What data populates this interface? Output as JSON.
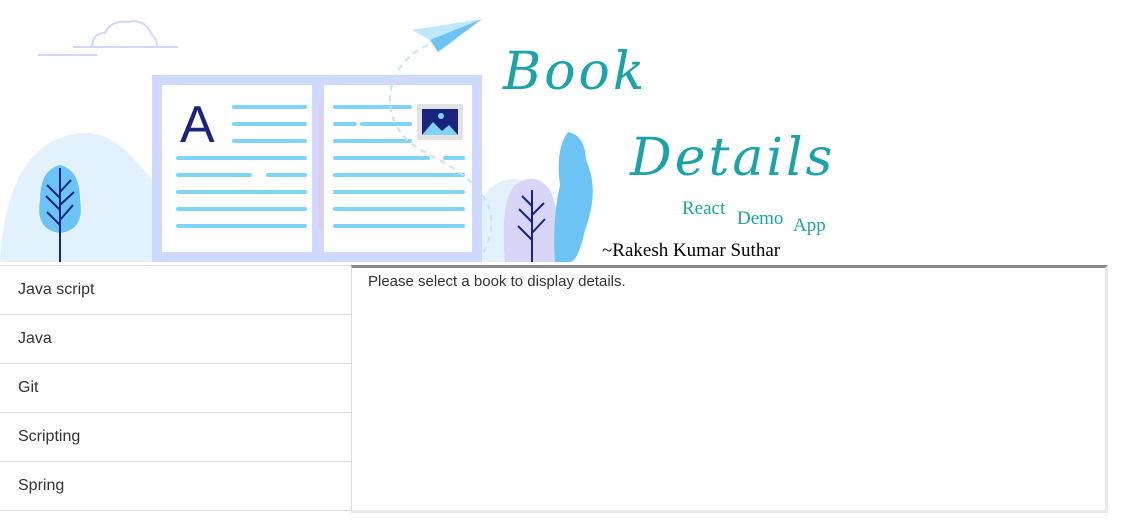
{
  "header": {
    "title_line1": "Book",
    "title_line2": "Details",
    "subtitle_words": [
      "React",
      "Demo",
      "App"
    ],
    "author": "~Rakesh Kumar Suthar",
    "illustration_letter": "A"
  },
  "books": [
    {
      "label": "Java script"
    },
    {
      "label": "Java"
    },
    {
      "label": "Git"
    },
    {
      "label": "Scripting"
    },
    {
      "label": "Spring"
    }
  ],
  "details": {
    "placeholder": "Please select a book to display details."
  },
  "colors": {
    "title": "#1aa3a8",
    "illustration_frame": "#cfd8ff",
    "illustration_lines": "#7fd3f7",
    "illustration_dark": "#1a237e",
    "panel_border": "#8a8a8a"
  }
}
